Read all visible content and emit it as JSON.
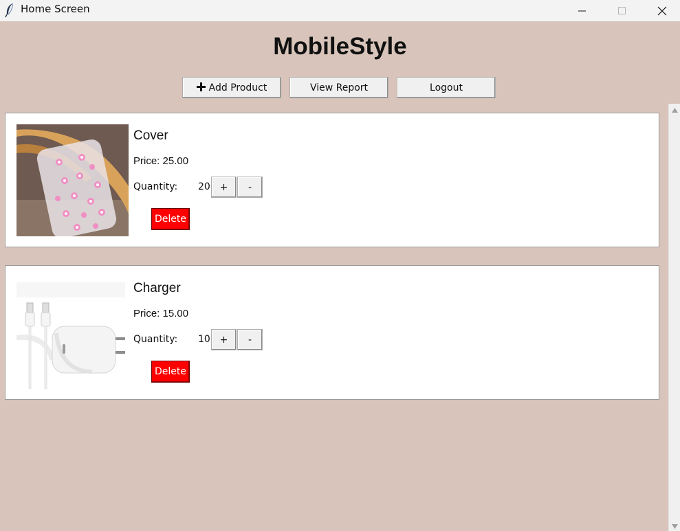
{
  "window": {
    "title": "Home Screen",
    "icon": "feather-icon"
  },
  "app": {
    "title": "MobileStyle"
  },
  "toolbar": {
    "add_icon": "plus-icon",
    "add_label": "Add Product",
    "report_label": "View Report",
    "logout_label": "Logout"
  },
  "products": [
    {
      "name": "Cover",
      "price": "Price: 25.00",
      "quantity_label": "Quantity:",
      "quantity": "20",
      "plus_label": "+",
      "minus_label": "-",
      "delete_label": "Delete",
      "image": "phone-case-image"
    },
    {
      "name": "Charger",
      "price": "Price: 15.00",
      "quantity_label": "Quantity:",
      "quantity": "10",
      "plus_label": "+",
      "minus_label": "-",
      "delete_label": "Delete",
      "image": "usb-c-charger-image"
    }
  ],
  "colors": {
    "background": "#d8c4ba",
    "delete_button": "#ff0000",
    "card": "#ffffff"
  }
}
